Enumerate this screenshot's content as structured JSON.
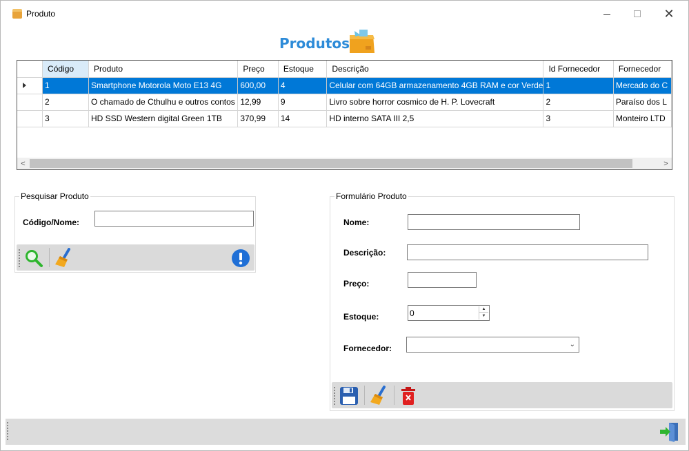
{
  "window": {
    "title": "Produto",
    "minimize": "—",
    "maximize": "☐",
    "close": "✕"
  },
  "header": {
    "title": "Produtos"
  },
  "grid": {
    "columns": [
      "Código",
      "Produto",
      "Preço",
      "Estoque",
      "Descrição",
      "Id Fornecedor",
      "Fornecedor"
    ],
    "rows": [
      [
        "1",
        "Smartphone Motorola Moto E13 4G",
        "600,00",
        "4",
        "Celular com 64GB armazenamento 4GB RAM e cor Verde",
        "1",
        "Mercado do C"
      ],
      [
        "2",
        "O chamado de Cthulhu e outros contos",
        "12,99",
        "9",
        "Livro sobre horror cosmico de H. P. Lovecraft",
        "2",
        "Paraíso dos L"
      ],
      [
        "3",
        "HD SSD Western digital Green 1TB",
        "370,99",
        "14",
        "HD interno SATA III 2,5",
        "3",
        "Monteiro LTD"
      ]
    ],
    "selected_row": 0,
    "scroll_left": "<",
    "scroll_right": ">"
  },
  "search": {
    "legend": "Pesquisar Produto",
    "label": "Código/Nome:",
    "value": "",
    "search_icon": "magnifier-icon",
    "clear_icon": "broom-icon",
    "info_icon": "info-icon"
  },
  "form": {
    "legend": "Formulário Produto",
    "nome_label": "Nome:",
    "nome_value": "",
    "descricao_label": "Descrição:",
    "descricao_value": "",
    "preco_label": "Preço:",
    "preco_value": "",
    "estoque_label": "Estoque:",
    "estoque_value": "0",
    "fornecedor_label": "Fornecedor:",
    "fornecedor_value": "",
    "save_icon": "floppy-disk-icon",
    "clear_icon": "broom-icon",
    "delete_icon": "trash-icon"
  },
  "statusbar": {
    "exit_icon": "exit-door-icon"
  },
  "colors": {
    "accent": "#2d8bd8",
    "selection": "#0078d7",
    "toolstrip": "#dadada",
    "delete": "#e02020"
  }
}
